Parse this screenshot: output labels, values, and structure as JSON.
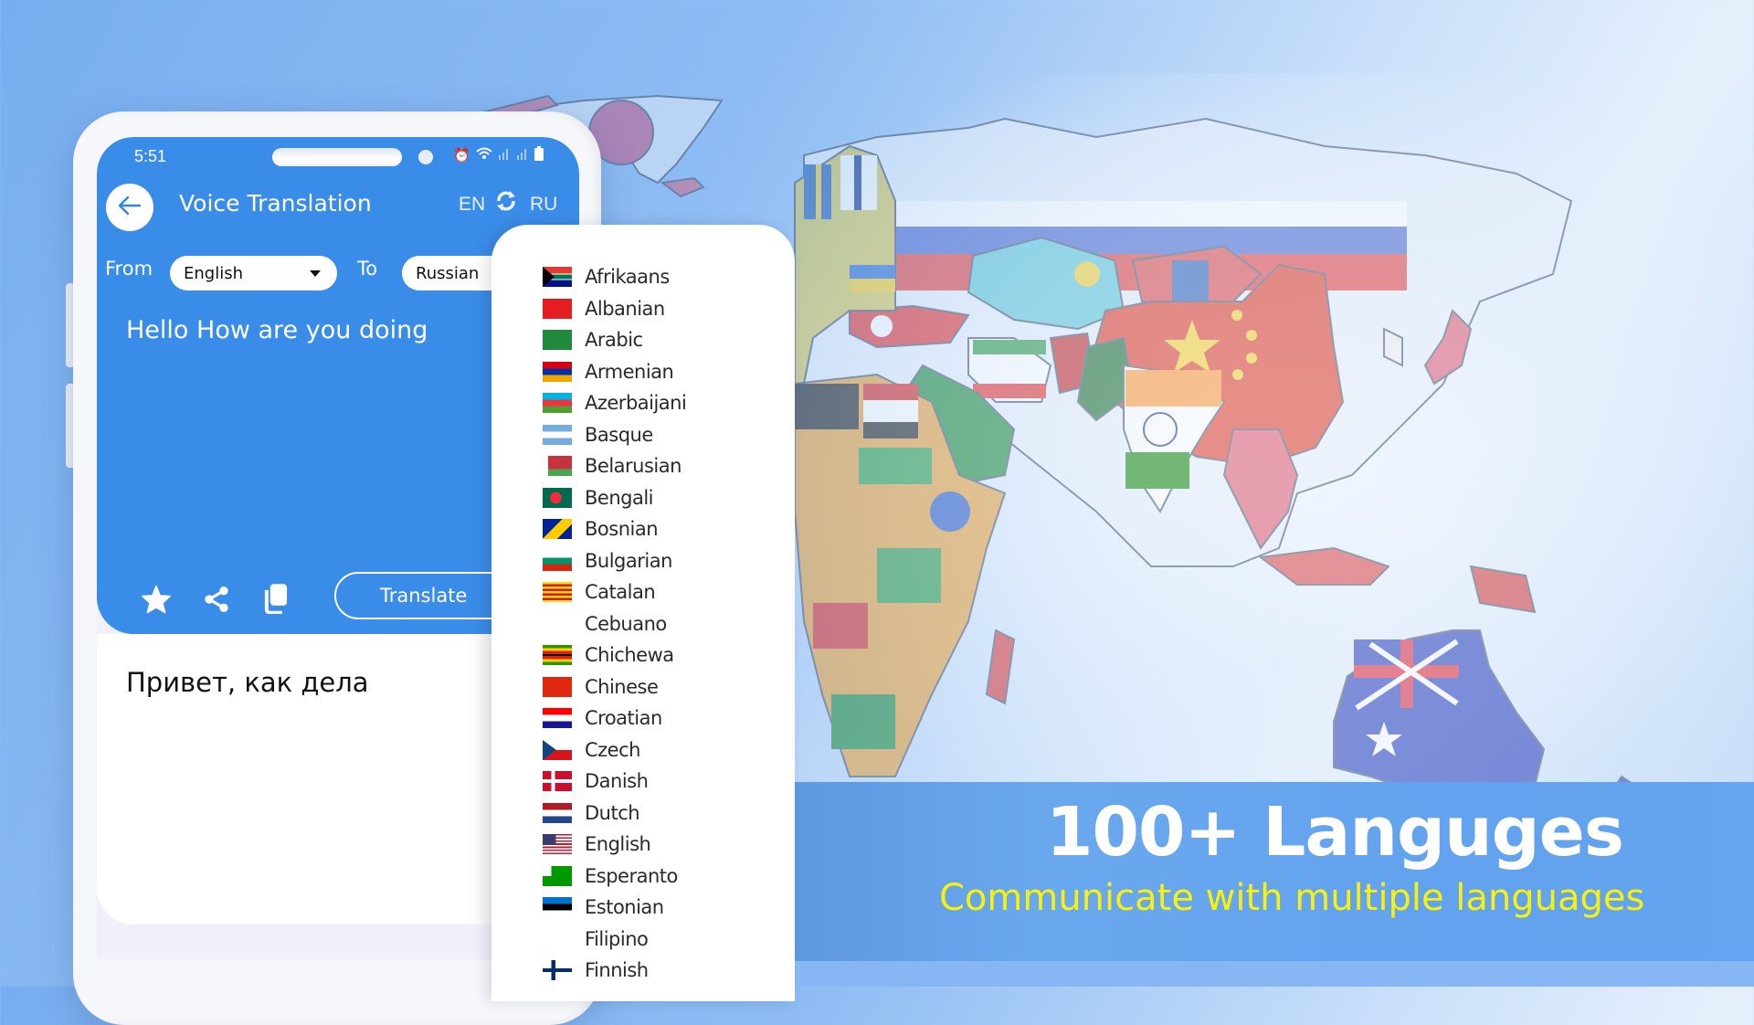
{
  "phone": {
    "status_bar": {
      "time": "5:51",
      "icons": [
        "alarm-icon",
        "wifi-icon",
        "signal-icon",
        "signal-icon",
        "battery-icon"
      ]
    },
    "app_bar": {
      "back_icon": "arrow-left-icon",
      "title": "Voice Translation",
      "source_code": "EN",
      "swap_icon": "swap-arrows-icon",
      "target_code": "RU"
    },
    "language_selectors": {
      "from_label": "From",
      "from_value": "English",
      "to_label": "To",
      "to_value": "Russian"
    },
    "source_text": "Hello How are you doing",
    "actions": {
      "favorite_icon": "star-icon",
      "share_icon": "share-icon",
      "copy_icon": "copy-icon",
      "translate_label": "Translate"
    },
    "translated_text": "Привет, как дела"
  },
  "language_list": [
    {
      "name": "Afrikaans",
      "flag": "south-africa-flag"
    },
    {
      "name": "Albanian",
      "flag": "albania-flag"
    },
    {
      "name": "Arabic",
      "flag": "saudi-arabia-flag"
    },
    {
      "name": "Armenian",
      "flag": "armenia-flag"
    },
    {
      "name": "Azerbaijani",
      "flag": "azerbaijan-flag"
    },
    {
      "name": "Basque",
      "flag": "argentina-flag"
    },
    {
      "name": "Belarusian",
      "flag": "belarus-flag"
    },
    {
      "name": "Bengali",
      "flag": "bangladesh-flag"
    },
    {
      "name": "Bosnian",
      "flag": "bosnia-flag"
    },
    {
      "name": "Bulgarian",
      "flag": "bulgaria-flag"
    },
    {
      "name": "Catalan",
      "flag": "catalonia-flag"
    },
    {
      "name": "Cebuano",
      "flag": "philippines-flag"
    },
    {
      "name": "Chichewa",
      "flag": "zimbabwe-flag"
    },
    {
      "name": "Chinese",
      "flag": "china-flag"
    },
    {
      "name": "Croatian",
      "flag": "croatia-flag"
    },
    {
      "name": "Czech",
      "flag": "czech-flag"
    },
    {
      "name": "Danish",
      "flag": "denmark-flag"
    },
    {
      "name": "Dutch",
      "flag": "netherlands-flag"
    },
    {
      "name": "English",
      "flag": "usa-flag"
    },
    {
      "name": "Esperanto",
      "flag": "esperanto-flag"
    },
    {
      "name": "Estonian",
      "flag": "estonia-flag"
    },
    {
      "name": "Filipino",
      "flag": "philippines-flag"
    },
    {
      "name": "Finnish",
      "flag": "finland-flag"
    }
  ],
  "banner": {
    "title": "100+ Languges",
    "subtitle": "Communicate with multiple languages",
    "title_color": "#ffffff",
    "subtitle_color": "#f7f20d"
  },
  "colors": {
    "primary_blue": "#3a8ce9",
    "banner_blue": "#62a2ee"
  }
}
